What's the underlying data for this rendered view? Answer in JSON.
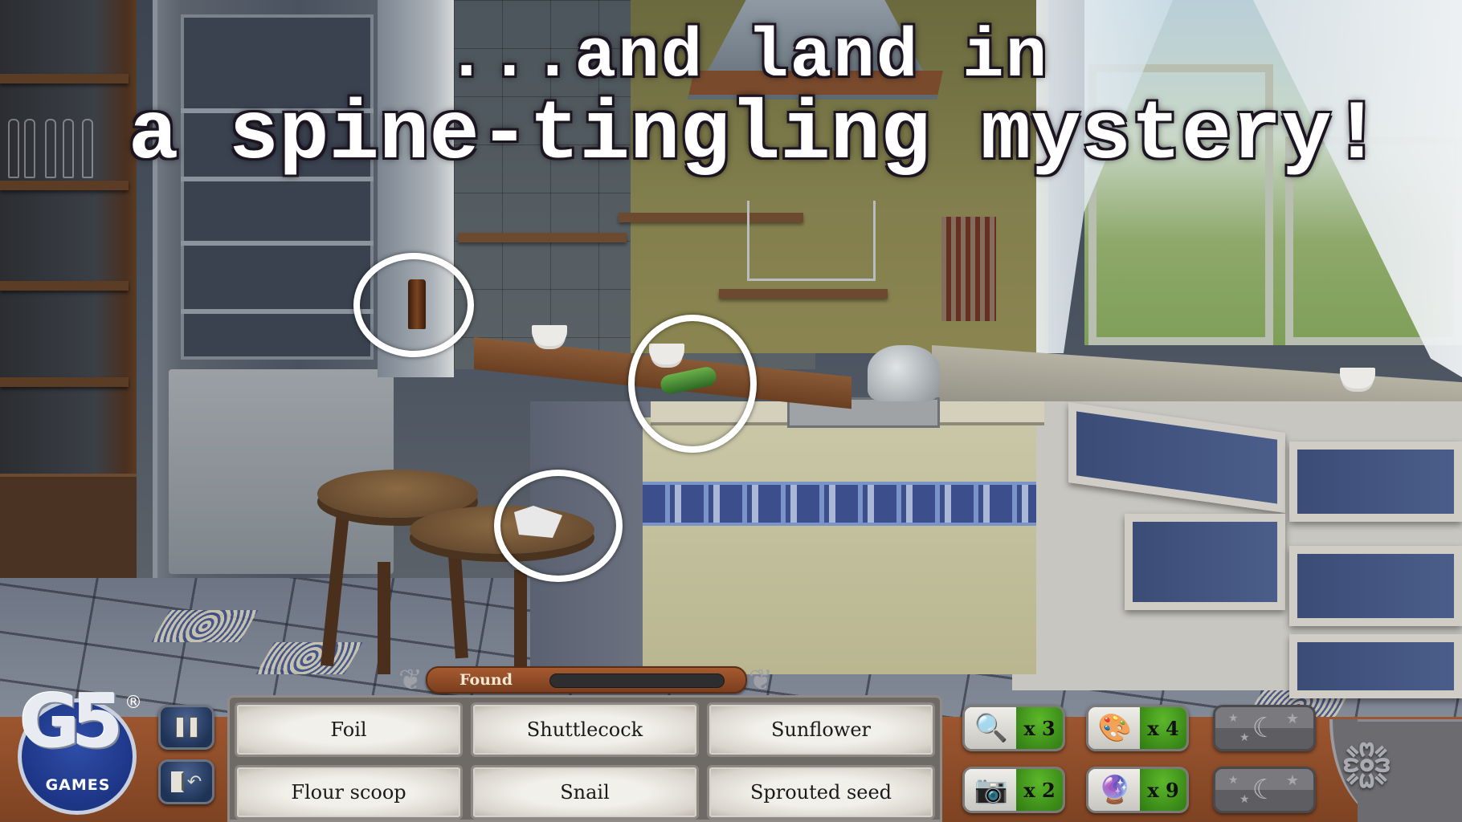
{
  "headline": {
    "line1": "...and land in",
    "line2": "a spine-tingling mystery!"
  },
  "brand": {
    "logo_text": "G5",
    "logo_subtext": "GAMES",
    "registered_mark": "®"
  },
  "controls": {
    "pause": "pause-icon",
    "exit": "exit-door-icon"
  },
  "found_bar": {
    "label": "Found",
    "progress_fraction": 0
  },
  "item_list": [
    {
      "label": "Foil"
    },
    {
      "label": "Shuttlecock"
    },
    {
      "label": "Sunflower"
    },
    {
      "label": "Flour scoop"
    },
    {
      "label": "Snail"
    },
    {
      "label": "Sprouted seed"
    }
  ],
  "powerups": [
    {
      "name": "magnifier",
      "icon": "🔍",
      "count": "x 3"
    },
    {
      "name": "palette",
      "icon": "🎨",
      "count": "x 4"
    },
    {
      "name": "camera",
      "icon": "📷",
      "count": "x 2"
    },
    {
      "name": "crystal-ball",
      "icon": "🔮",
      "count": "x 9"
    }
  ],
  "locked_slots": [
    {
      "icon": "☾"
    },
    {
      "icon": "☾"
    }
  ],
  "hint_markers": 3,
  "colors": {
    "hud_orange": "#8e4a26",
    "powerup_green": "#46a01e",
    "panel_gray": "#6e6a66",
    "button_blue": "#2a4270",
    "logo_blue": "#1d3585"
  }
}
